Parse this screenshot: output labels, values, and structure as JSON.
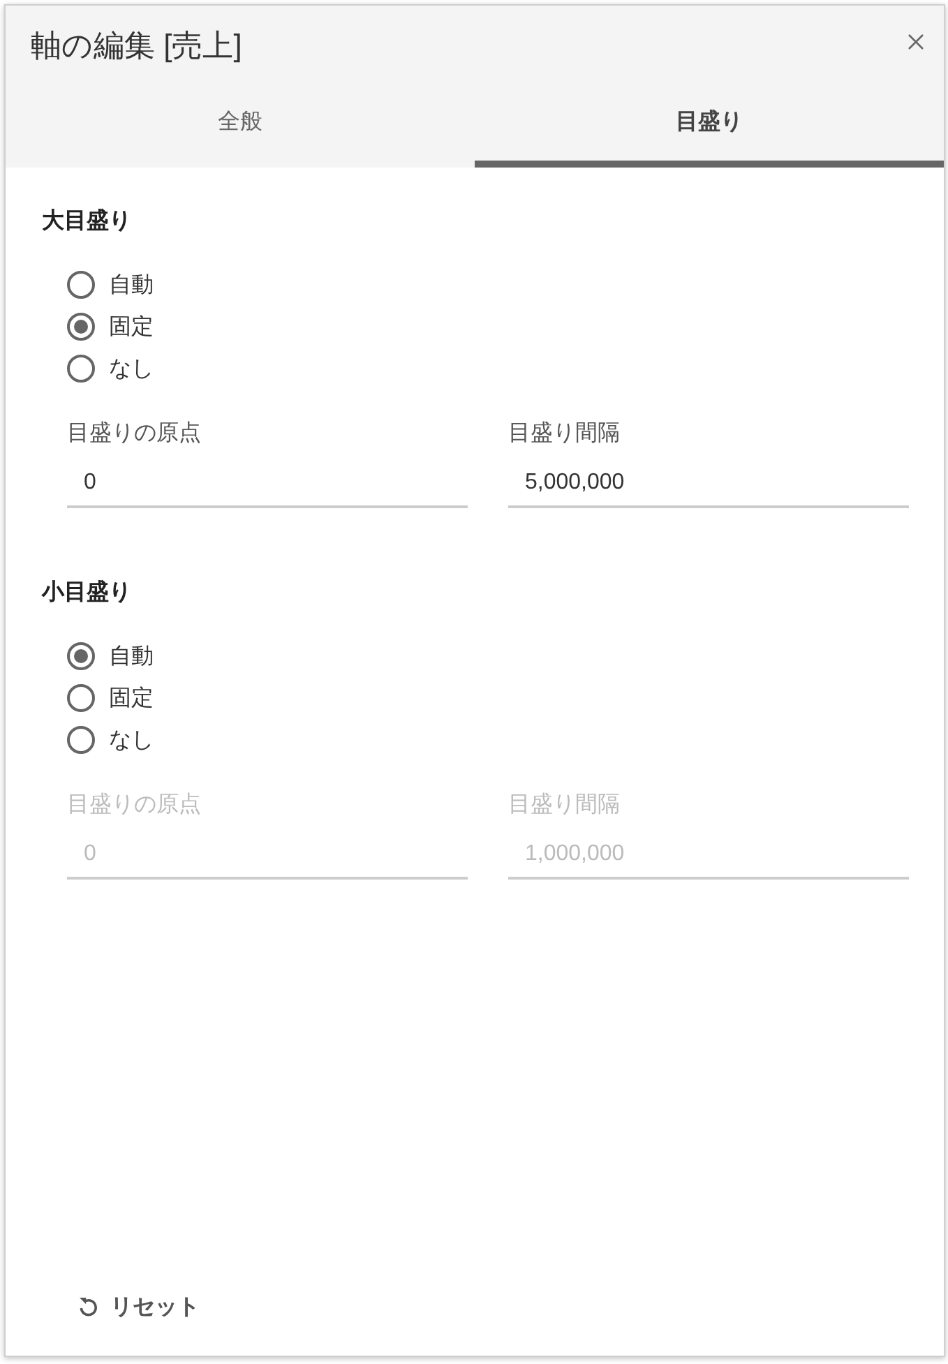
{
  "dialog": {
    "title": "軸の編集 [売上]"
  },
  "tabs": [
    {
      "label": "全般",
      "selected": false
    },
    {
      "label": "目盛り",
      "selected": true
    }
  ],
  "sections": [
    {
      "heading": "大目盛り",
      "options": [
        {
          "label": "自動",
          "selected": false
        },
        {
          "label": "固定",
          "selected": true
        },
        {
          "label": "なし",
          "selected": false
        }
      ],
      "fields": [
        {
          "label": "目盛りの原点",
          "value": "0",
          "disabled": false
        },
        {
          "label": "目盛り間隔",
          "value": "5,000,000",
          "disabled": false
        }
      ]
    },
    {
      "heading": "小目盛り",
      "options": [
        {
          "label": "自動",
          "selected": true
        },
        {
          "label": "固定",
          "selected": false
        },
        {
          "label": "なし",
          "selected": false
        }
      ],
      "fields": [
        {
          "label": "目盛りの原点",
          "value": "0",
          "disabled": true
        },
        {
          "label": "目盛り間隔",
          "value": "1,000,000",
          "disabled": true
        }
      ]
    }
  ],
  "reset_button": {
    "label": "リセット"
  }
}
